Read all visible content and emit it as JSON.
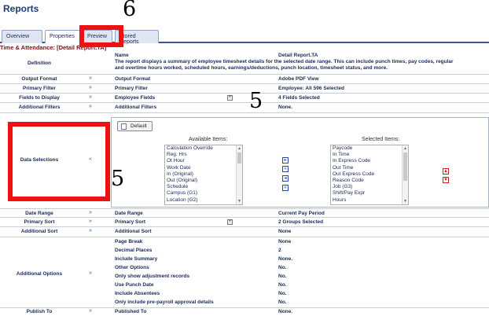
{
  "page": {
    "title": "Reports"
  },
  "tabs": [
    {
      "label": "Overview"
    },
    {
      "label": "Properties"
    },
    {
      "label": "Preview"
    },
    {
      "label": "Stored Reports"
    }
  ],
  "section": {
    "title": "Time & Attendance: [Detail Report.TA]"
  },
  "definition": {
    "label": "Definition",
    "name_header": "Name",
    "name_value": "Detail Report.TA",
    "description": "The report displays a summary of employee timesheet details for the selected date range. This can include punch times, pay codes, regular and overtime hours worked, scheduled hours, earnings/deductions, punch location, timesheet status, and more."
  },
  "rows": {
    "output_format": {
      "label": "Output Format",
      "name": "Output Format",
      "value": "Adobe PDF View"
    },
    "primary_filter": {
      "label": "Primary Filter",
      "name": "Primary Filter",
      "value": "Employee: All 596 Selected"
    },
    "fields_to_display": {
      "label": "Fields to Display",
      "name": "Employee Fields",
      "value": "4 Fields Selected"
    },
    "additional_filters": {
      "label": "Additional Filters",
      "name": "Additional Filters",
      "value": "None."
    },
    "data_selections": {
      "label": "Data Selections"
    },
    "date_range": {
      "label": "Date Range",
      "name": "Date Range",
      "value": "Current Pay Period"
    },
    "primary_sort": {
      "label": "Primary Sort",
      "name": "Primary Sort",
      "value": "2 Groups Selected"
    },
    "additional_sort": {
      "label": "Additional Sort",
      "name": "Additional Sort",
      "value": "None"
    },
    "publish_to": {
      "label": "Publish To",
      "name": "Published To",
      "value": "None."
    }
  },
  "data_selections": {
    "default_button": "Default",
    "available_title": "Available Items:",
    "selected_title": "Selected Items:",
    "available_items": [
      "Calculation Override",
      "Reg. Hrs",
      "Ot Hour",
      "Work Date",
      "In (Original)",
      "Out (Original)",
      "Schedule",
      "Campus (G1)",
      "Location (G2)"
    ],
    "selected_items": [
      "Paycode",
      "In Time",
      "In Express Code",
      "Out Time",
      "Out Express Code",
      "Reason Code",
      "Job (G3)",
      "Shift/Pay Expr",
      "Hours"
    ]
  },
  "additional_options": {
    "label": "Additional Options",
    "items": [
      {
        "name": "Page Break",
        "value": "None"
      },
      {
        "name": "Decimal Places",
        "value": "2"
      },
      {
        "name": "Include Summary",
        "value": "None."
      },
      {
        "name": "Other Options",
        "value": "No."
      },
      {
        "name": "Only show adjustment records",
        "value": "No."
      },
      {
        "name": "Use Punch Date",
        "value": "No."
      },
      {
        "name": "Include Absentees",
        "value": "No."
      },
      {
        "name": "Only include pre-payroll approval details",
        "value": "No."
      }
    ]
  },
  "annotations": {
    "a1": "6",
    "a2": "5",
    "a3": "5"
  },
  "icons": {
    "expand": "chevron-double-down-icon",
    "collapse": "chevron-double-up-icon",
    "plus": "plus-box-icon"
  },
  "colors": {
    "accent": "#3b5998",
    "section_title": "#7a1010",
    "highlight": "#ee1111"
  }
}
